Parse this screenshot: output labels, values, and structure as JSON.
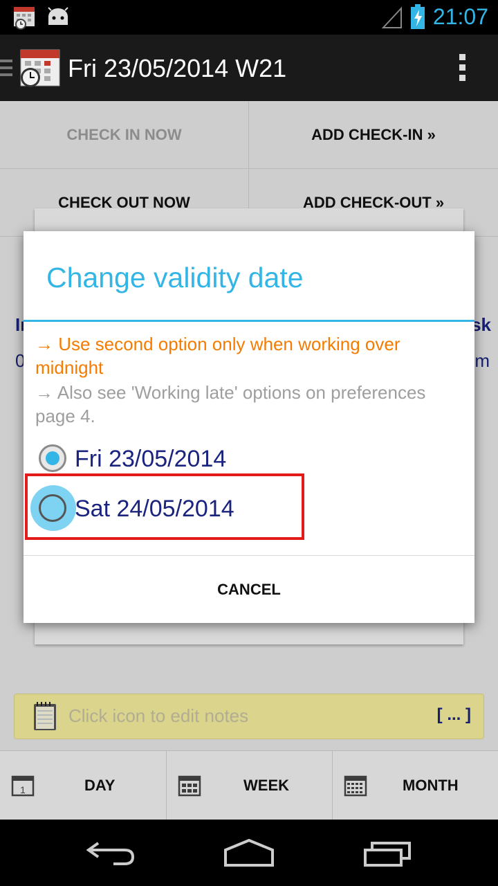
{
  "status_bar": {
    "time": "21:07",
    "icons": [
      "calendar-clock-icon",
      "android-icon",
      "signal-icon",
      "battery-charging-icon"
    ]
  },
  "action_bar": {
    "title": "Fri 23/05/2014 W21",
    "icons": [
      "menu-icon",
      "app-calendar-icon",
      "overflow-icon"
    ]
  },
  "content": {
    "row1": {
      "left": "CHECK IN NOW",
      "right": "ADD CHECK-IN »"
    },
    "row2": {
      "left": "CHECK OUT NOW",
      "right": "ADD CHECK-OUT »"
    },
    "background_left_bold": "In",
    "background_left_value": "0",
    "background_right_bold": "sk",
    "background_right_value": "m",
    "notes": {
      "placeholder": "Click icon to edit notes",
      "button": "[ ... ]"
    },
    "bottom_nav": [
      {
        "label": "DAY",
        "icon": "calendar-day-icon"
      },
      {
        "label": "WEEK",
        "icon": "calendar-week-icon"
      },
      {
        "label": "MONTH",
        "icon": "calendar-month-icon"
      }
    ]
  },
  "dialog": {
    "title": "Change validity date",
    "message1": "→ Use second option only when working over midnight",
    "message2": "→ Also see 'Working late' options on preferences page 4.",
    "options": [
      {
        "label": "Fri 23/05/2014",
        "selected": true
      },
      {
        "label": "Sat 24/05/2014",
        "selected": false
      }
    ],
    "cancel": "CANCEL"
  },
  "nav_bar": [
    "back-icon",
    "home-icon",
    "recents-icon"
  ],
  "colors": {
    "accent": "#33b5e5",
    "warning": "#f57c00",
    "highlight": "#e31b1b",
    "text_dark": "#1a237e"
  }
}
